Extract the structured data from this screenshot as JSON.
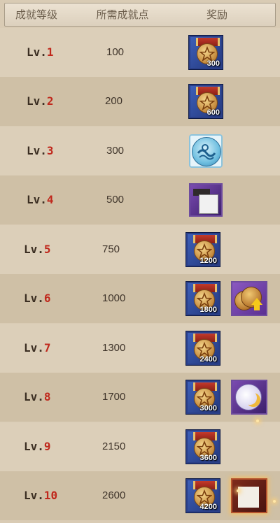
{
  "header": {
    "col_level": "成就等级",
    "col_points": "所需成就点",
    "col_reward": "奖励"
  },
  "rows": [
    {
      "prefix": "Lv.",
      "num": "1",
      "points": "100",
      "rewards": [
        {
          "icon": "star-medal-icon",
          "qty": "300"
        }
      ]
    },
    {
      "prefix": "Lv.",
      "num": "2",
      "points": "200",
      "rewards": [
        {
          "icon": "star-medal-icon",
          "qty": "600"
        }
      ]
    },
    {
      "prefix": "Lv.",
      "num": "3",
      "points": "300",
      "rewards": [
        {
          "icon": "wave-emblem-icon",
          "qty": ""
        }
      ]
    },
    {
      "prefix": "Lv.",
      "num": "4",
      "points": "500",
      "rewards": [
        {
          "icon": "frame-item-icon",
          "qty": ""
        }
      ]
    },
    {
      "prefix": "Lv.",
      "num": "5",
      "points": "750",
      "rewards": [
        {
          "icon": "star-medal-icon",
          "qty": "1200"
        }
      ]
    },
    {
      "prefix": "Lv.",
      "num": "6",
      "points": "1000",
      "rewards": [
        {
          "icon": "star-medal-icon",
          "qty": "1800"
        },
        {
          "icon": "coin-upgrade-icon",
          "qty": ""
        }
      ]
    },
    {
      "prefix": "Lv.",
      "num": "7",
      "points": "1300",
      "rewards": [
        {
          "icon": "star-medal-icon",
          "qty": "2400"
        }
      ]
    },
    {
      "prefix": "Lv.",
      "num": "8",
      "points": "1700",
      "rewards": [
        {
          "icon": "star-medal-icon",
          "qty": "3000"
        },
        {
          "icon": "moon-emblem-icon",
          "qty": ""
        }
      ]
    },
    {
      "prefix": "Lv.",
      "num": "9",
      "points": "2150",
      "rewards": [
        {
          "icon": "star-medal-icon",
          "qty": "3600"
        }
      ]
    },
    {
      "prefix": "Lv.",
      "num": "10",
      "points": "2600",
      "rewards": [
        {
          "icon": "star-medal-icon",
          "qty": "4200"
        },
        {
          "icon": "red-frame-item-icon",
          "qty": ""
        }
      ]
    }
  ]
}
